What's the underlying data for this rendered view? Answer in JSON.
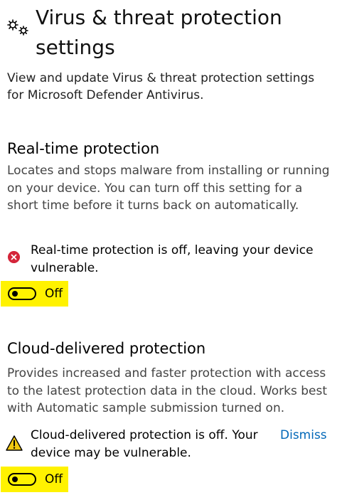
{
  "page": {
    "title": "Virus & threat protection settings",
    "intro": "View and update Virus & threat protection settings for Microsoft Defender Antivirus.",
    "title_icon": "gears-icon"
  },
  "realtime": {
    "heading": "Real-time protection",
    "description": "Locates and stops malware from installing or running on your device. You can turn off this setting for a short time before it turns back on automatically.",
    "alert_icon": "error-icon",
    "alert_text": "Real-time protection is off, leaving your device vulnerable.",
    "toggle_label": "Off",
    "toggle_on": false
  },
  "cloud": {
    "heading": "Cloud-delivered protection",
    "description": "Provides increased and faster protection with access to the latest protection data in the cloud. Works best with Automatic sample submission turned on.",
    "alert_icon": "warning-icon",
    "alert_text": "Cloud-delivered protection is off. Your device may be vulnerable.",
    "dismiss_label": "Dismiss",
    "toggle_label": "Off",
    "toggle_on": false
  },
  "colors": {
    "highlight": "#fff200",
    "error": "#d4253a",
    "warning": "#f2c811",
    "link": "#0067b8"
  }
}
